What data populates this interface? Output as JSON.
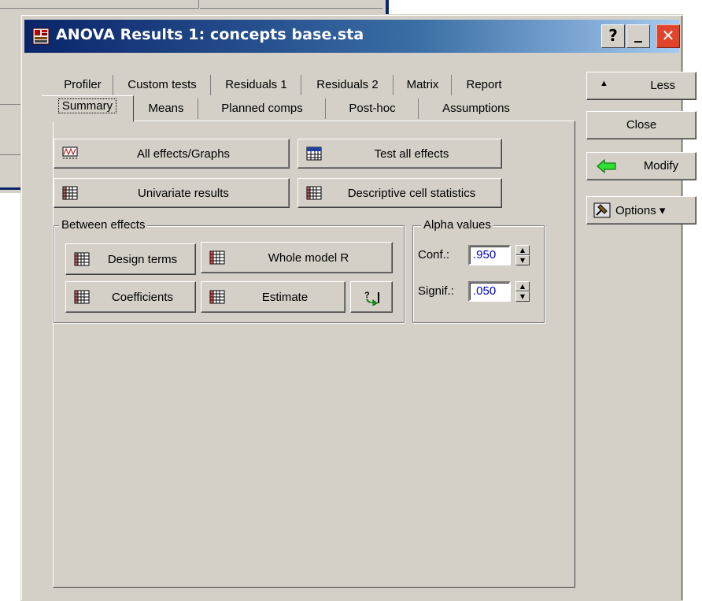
{
  "window": {
    "title": "ANOVA Results 1: concepts base.sta",
    "help_label": "?",
    "minimize_label": "_",
    "close_label": "✕"
  },
  "tabs_row1": [
    "Profiler",
    "Custom tests",
    "Residuals 1",
    "Residuals 2",
    "Matrix",
    "Report"
  ],
  "tabs_row2": [
    "Summary",
    "Means",
    "Planned comps",
    "Post-hoc",
    "Assumptions"
  ],
  "active_tab": "Summary",
  "main_buttons": {
    "all_effects": "All effects/Graphs",
    "test_all": "Test all effects",
    "univariate": "Univariate results",
    "descriptive": "Descriptive cell statistics"
  },
  "between_effects": {
    "label": "Between effects",
    "design_terms": "Design terms",
    "whole_model": "Whole model R",
    "coefficients": "Coefficients",
    "estimate": "Estimate"
  },
  "alpha": {
    "label": "Alpha values",
    "conf_label": "Conf.:",
    "conf_value": ".950",
    "signif_label": "Signif.:",
    "signif_value": ".050"
  },
  "side_buttons": {
    "less": "Less",
    "close": "Close",
    "modify": "Modify",
    "options": "Options ▾"
  },
  "colors": {
    "title_start": "#0a246a",
    "title_end": "#a6caf0",
    "face": "#d4d0c8",
    "field_text": "#0000c0"
  }
}
